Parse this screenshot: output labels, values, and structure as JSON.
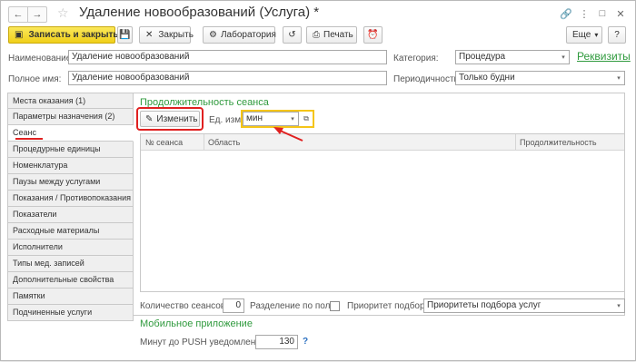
{
  "window": {
    "title": "Удаление новообразований (Услуга) *",
    "nav_back": "←",
    "nav_forward": "→",
    "star": "☆",
    "icons": [
      "link-icon",
      "more-icon",
      "maximize-icon",
      "close-icon"
    ],
    "icon_glyphs": [
      "🔗",
      "⋮",
      "□",
      "✕"
    ]
  },
  "toolbar": {
    "save_close_label": "Записать и закрыть",
    "save_icon": "💾",
    "close_label": "Закрыть",
    "lab_label": "Лаборатория",
    "history_icon": "↺",
    "print_label": "Печать",
    "alarm_icon": "⏰",
    "more_label": "Еще",
    "help_label": "?"
  },
  "header": {
    "name_label": "Наименование:",
    "name_value": "Удаление новообразований",
    "fullname_label": "Полное имя:",
    "fullname_value": "Удаление новообразований",
    "category_label": "Категория:",
    "category_value": "Процедура",
    "periodicity_label": "Периодичность:",
    "periodicity_value": "Только будни",
    "requisites_link": "Реквизиты"
  },
  "tabs": [
    {
      "label": "Места оказания (1)"
    },
    {
      "label": "Параметры назначения (2)"
    },
    {
      "label": "Сеанс"
    },
    {
      "label": "Процедурные единицы"
    },
    {
      "label": "Номенклатура"
    },
    {
      "label": "Паузы между услугами"
    },
    {
      "label": "Показания / Противопоказания"
    },
    {
      "label": "Показатели"
    },
    {
      "label": "Расходные материалы"
    },
    {
      "label": "Исполнители"
    },
    {
      "label": "Типы мед. записей"
    },
    {
      "label": "Дополнительные свойства"
    },
    {
      "label": "Памятки"
    },
    {
      "label": "Подчиненные услуги"
    }
  ],
  "active_tab": "Сеанс",
  "session": {
    "title": "Продолжительность сеанса",
    "edit_button": "Изменить",
    "unit_label": "Ед. изм.:",
    "unit_value": "мин",
    "columns": [
      "№ сеанса",
      "Область",
      "Продолжительность"
    ],
    "rows": []
  },
  "bottom": {
    "session_count_label": "Количество сеансов:",
    "session_count_value": "0",
    "gender_split_label": "Разделение по полу:",
    "gender_split_checked": false,
    "priority_label": "Приоритет подбора:",
    "priority_value": "Приоритеты подбора услуг",
    "mobile_title": "Мобильное приложение",
    "push_label": "Минут до PUSH уведомления:",
    "push_value": "130",
    "push_help": "?"
  },
  "colors": {
    "primary": "#f0cf1a",
    "link": "#2f9a3d",
    "highlight_red": "#e02020",
    "highlight_yellow": "#f5c518"
  }
}
